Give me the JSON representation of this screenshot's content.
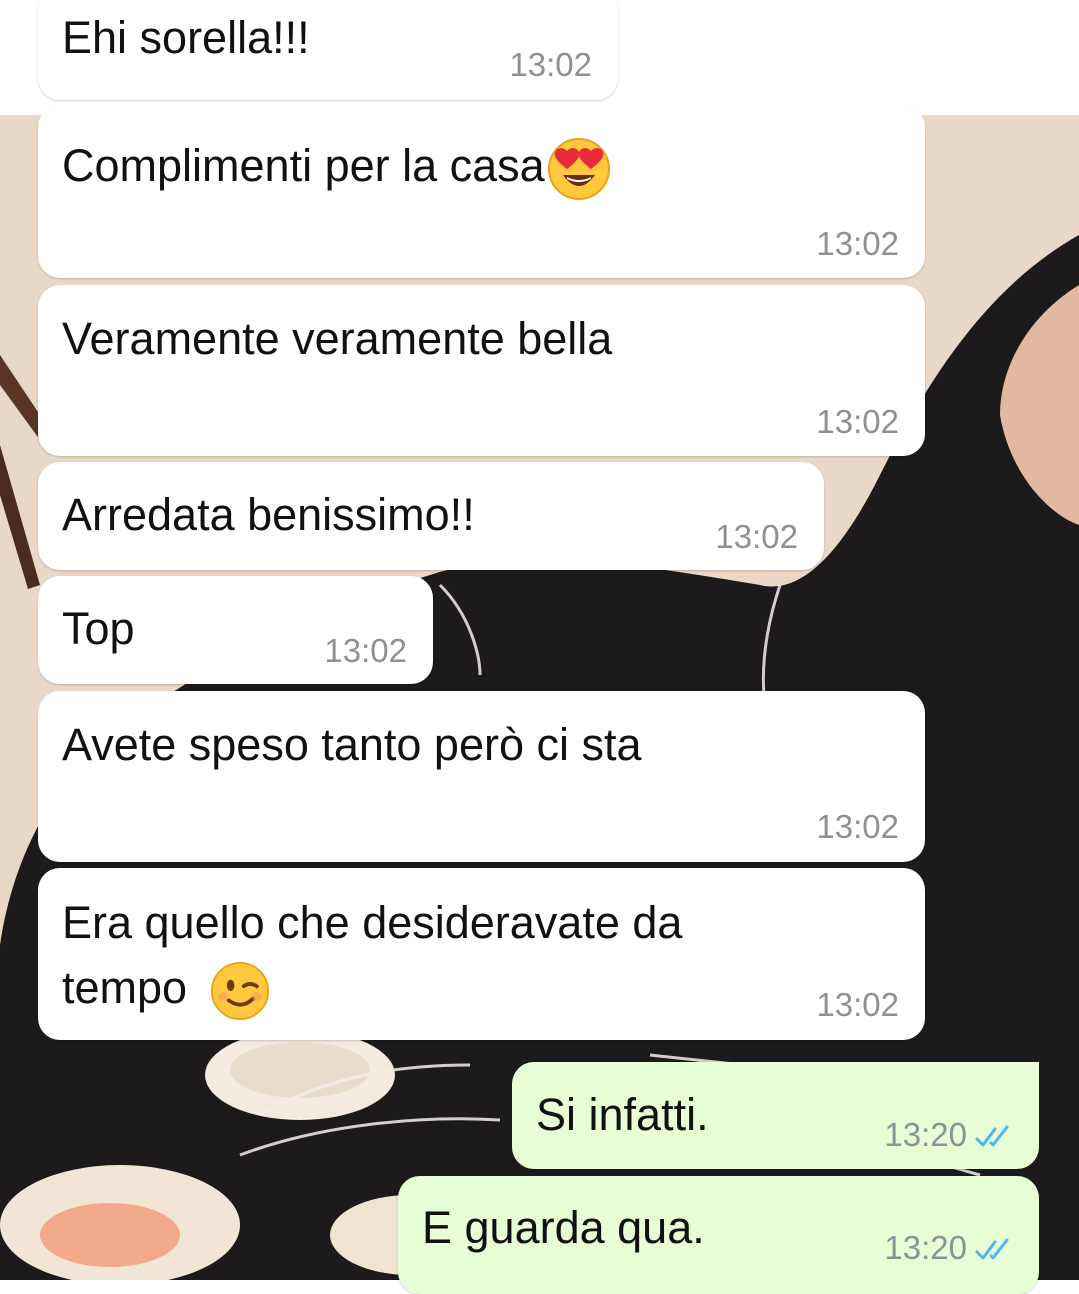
{
  "chat": {
    "messages": [
      {
        "direction": "incoming",
        "text": "Ehi sorella!!!",
        "time": "13:02"
      },
      {
        "direction": "incoming",
        "text": "Complimenti per la casa",
        "emoji": "heart-eyes-emoji",
        "time": "13:02"
      },
      {
        "direction": "incoming",
        "text": "Veramente veramente bella",
        "time": "13:02"
      },
      {
        "direction": "incoming",
        "text": "Arredata benissimo!!",
        "time": "13:02"
      },
      {
        "direction": "incoming",
        "text": "Top",
        "time": "13:02"
      },
      {
        "direction": "incoming",
        "text": "Avete speso tanto però ci sta",
        "time": "13:02"
      },
      {
        "direction": "incoming",
        "line1": "Era quello che desideravate da",
        "line2": "tempo",
        "emoji": "winking-face-emoji",
        "time": "13:02"
      },
      {
        "direction": "outgoing",
        "text": "Si infatti.",
        "time": "13:20",
        "status": "read-double-check-icon"
      },
      {
        "direction": "outgoing",
        "text": "E guarda qua.",
        "time": "13:20",
        "status": "read-double-check-icon"
      }
    ]
  },
  "colors": {
    "incoming_bubble": "#ffffff",
    "outgoing_bubble": "#e7fdd5",
    "read_ticks": "#4fb6ec",
    "timestamp": "#8c9194",
    "wallpaper": "#e9d8c8"
  }
}
